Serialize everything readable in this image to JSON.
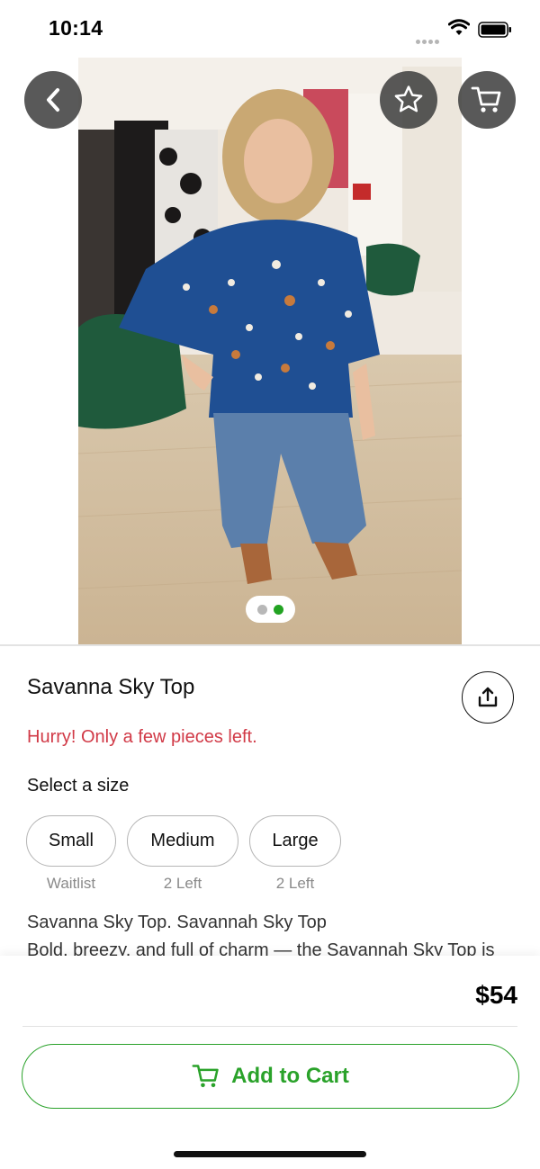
{
  "status_bar": {
    "time": "10:14"
  },
  "top_actions": {
    "back_icon": "chevron-left-icon",
    "favorite_icon": "star-icon",
    "cart_icon": "cart-icon"
  },
  "gallery": {
    "image_count": 2,
    "active_index": 1
  },
  "product": {
    "title": "Savanna Sky Top",
    "stock_warning": "Hurry! Only a few pieces left.",
    "size_prompt": "Select a size",
    "sizes": [
      {
        "label": "Small",
        "note": "Waitlist"
      },
      {
        "label": "Medium",
        "note": "2 Left"
      },
      {
        "label": "Large",
        "note": "2 Left"
      }
    ],
    "description_line1": "Savanna Sky Top. Savannah Sky Top",
    "description_line2": "Bold, breezy, and full of charm — the Savannah Sky Top is"
  },
  "purchase": {
    "price": "$54",
    "add_to_cart_label": "Add to Cart"
  },
  "colors": {
    "accent_green": "#2aa22a",
    "warning_red": "#d13a47"
  }
}
